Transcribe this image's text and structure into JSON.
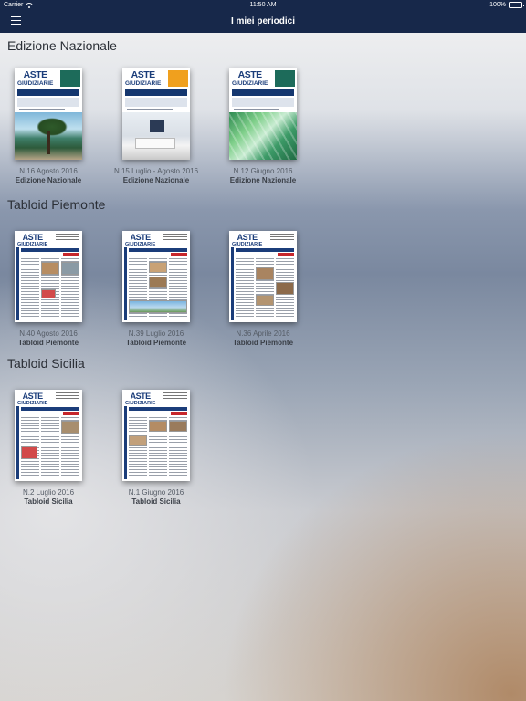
{
  "status_bar": {
    "carrier": "Carrier",
    "time": "11:50 AM",
    "battery": "100%"
  },
  "nav": {
    "title": "I miei periodici",
    "menu_icon": "hamburger-menu-icon"
  },
  "sections": [
    {
      "title": "Edizione Nazionale",
      "issues": [
        {
          "number": "N.16 Agosto 2016",
          "edition": "Edizione Nazionale"
        },
        {
          "number": "N.15  Luglio - Agosto 2016",
          "edition": "Edizione Nazionale"
        },
        {
          "number": "N.12 Giugno 2016",
          "edition": "Edizione Nazionale"
        }
      ]
    },
    {
      "title": "Tabloid Piemonte",
      "issues": [
        {
          "number": "N.40 Agosto 2016",
          "edition": "Tabloid Piemonte"
        },
        {
          "number": "N.39 Luglio 2016",
          "edition": "Tabloid Piemonte"
        },
        {
          "number": "N.36 Aprile 2016",
          "edition": "Tabloid Piemonte"
        }
      ]
    },
    {
      "title": "Tabloid Sicilia",
      "issues": [
        {
          "number": "N.2 Luglio 2016",
          "edition": "Tabloid Sicilia"
        },
        {
          "number": "N.1 Giugno 2016",
          "edition": "Tabloid Sicilia"
        }
      ]
    }
  ],
  "cover_logo": {
    "main": "ASTE",
    "sub": "GIUDIZIARIE"
  },
  "colors": {
    "nav_bg": "#17284a",
    "logo_blue": "#1b3d7a",
    "tabloid_red": "#c6262b"
  }
}
